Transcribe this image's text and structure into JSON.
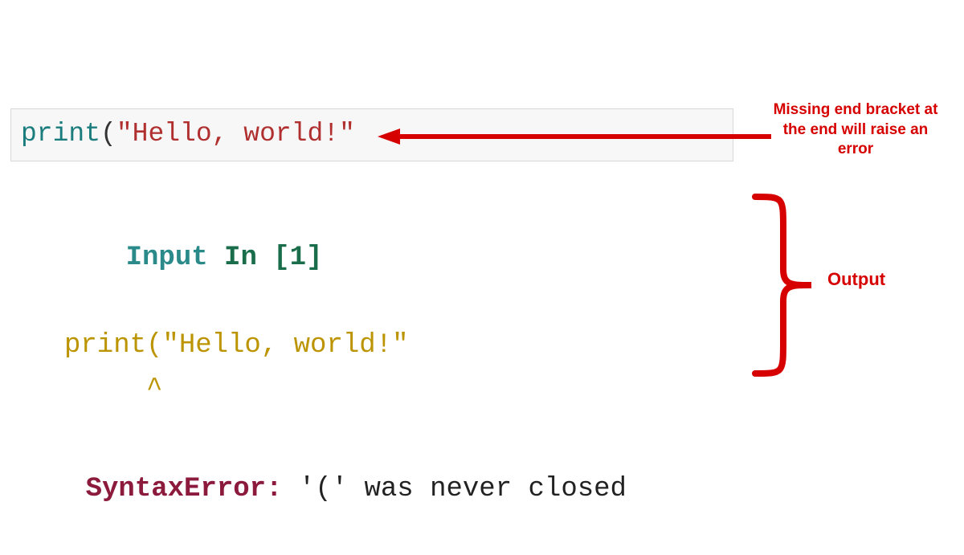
{
  "code_cell": {
    "fn": "print",
    "open_paren": "(",
    "string": "\"Hello, world!\""
  },
  "output": {
    "input_word": "Input ",
    "in_word": "In ",
    "bracket": "[1]",
    "echo_line": "print(\"Hello, world!\"",
    "caret_line": "     ^",
    "error_name": "SyntaxError:",
    "error_msg": " '(' was never closed"
  },
  "annotations": {
    "missing_bracket": "Missing end bracket at the end will raise an error",
    "output_label": "Output"
  },
  "colors": {
    "annotation_red": "#d60000"
  }
}
